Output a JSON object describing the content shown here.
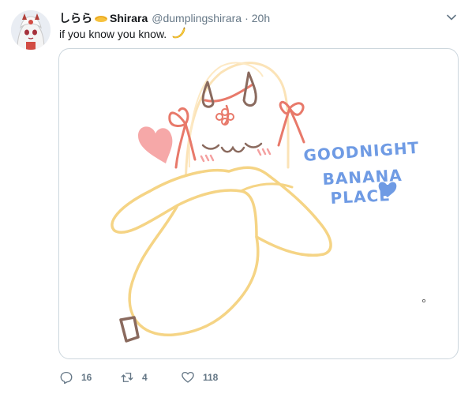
{
  "tweet": {
    "display_name": "しらら",
    "display_name_suffix": "Shirara",
    "handle": "@dumplingshirara",
    "separator": "·",
    "time": "20h",
    "text": "if you know you know.",
    "emoji": "banana-emoji"
  },
  "media": {
    "art_text": [
      "GOODNIGHT",
      "BANANA",
      "PLACE"
    ],
    "colors": {
      "banana_outline": "#f5d485",
      "banana_fill": "#ffffff",
      "bow": "#e8796a",
      "heart": "#f6a8a8",
      "horn": "#8a6a5e",
      "text": "#6f9be4",
      "peel_outline": "#fbe3b7"
    }
  },
  "actions": {
    "reply_count": "16",
    "retweet_count": "4",
    "like_count": "118"
  },
  "icons": {
    "reply": "reply-icon",
    "retweet": "retweet-icon",
    "like": "heart-icon",
    "caret": "chevron-down-icon"
  }
}
